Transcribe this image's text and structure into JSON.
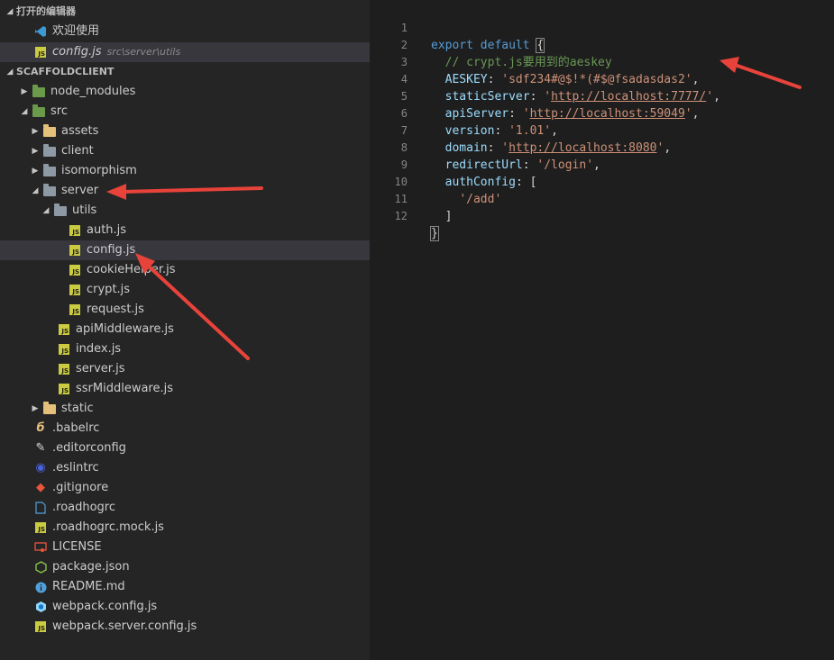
{
  "open_editors": {
    "header": "打开的编辑器",
    "items": [
      {
        "label": "欢迎使用",
        "icon": "vscode-icon"
      },
      {
        "label": "config.js",
        "path": "src\\server\\utils",
        "icon": "js-icon"
      }
    ]
  },
  "explorer": {
    "header": "SCAFFOLDCLIENT",
    "items": [
      {
        "label": "node_modules"
      },
      {
        "label": "src"
      },
      {
        "label": "assets"
      },
      {
        "label": "client"
      },
      {
        "label": "isomorphism"
      },
      {
        "label": "server"
      },
      {
        "label": "utils"
      },
      {
        "label": "auth.js"
      },
      {
        "label": "config.js"
      },
      {
        "label": "cookieHelper.js"
      },
      {
        "label": "crypt.js"
      },
      {
        "label": "request.js"
      },
      {
        "label": "apiMiddleware.js"
      },
      {
        "label": "index.js"
      },
      {
        "label": "server.js"
      },
      {
        "label": "ssrMiddleware.js"
      },
      {
        "label": "static"
      },
      {
        "label": ".babelrc"
      },
      {
        "label": ".editorconfig"
      },
      {
        "label": ".eslintrc"
      },
      {
        "label": ".gitignore"
      },
      {
        "label": ".roadhogrc"
      },
      {
        "label": ".roadhogrc.mock.js"
      },
      {
        "label": "LICENSE"
      },
      {
        "label": "package.json"
      },
      {
        "label": "README.md"
      },
      {
        "label": "webpack.config.js"
      },
      {
        "label": "webpack.server.config.js"
      }
    ]
  },
  "editor": {
    "line_numbers": [
      "1",
      "2",
      "3",
      "4",
      "5",
      "6",
      "7",
      "8",
      "9",
      "10",
      "11",
      "12"
    ],
    "code": {
      "l1_kw": "export default",
      "l1_brace": "{",
      "l2_comment": "// crypt.js要用到的aeskey",
      "l3_key": "AESKEY",
      "l3_val": "'sdf234#@$!*(#$@fsadasdas2'",
      "l4_key": "staticServer",
      "l4_url": "http://localhost:7777/",
      "l5_key": "apiServer",
      "l5_url": "http://localhost:59049",
      "l6_key": "version",
      "l6_val": "'1.01'",
      "l7_key": "domain",
      "l7_url": "http://localhost:8080",
      "l8_key": "redirectUrl",
      "l8_val": "'/login'",
      "l9_key": "authConfig",
      "l9_bracket": "[",
      "l10_val": "'/add'",
      "l11_bracket": "]",
      "l12_brace": "}"
    }
  },
  "colors": {
    "annotation_arrow": "#e8433a",
    "sidebar_bg": "#252526",
    "editor_bg": "#1e1e1e"
  }
}
